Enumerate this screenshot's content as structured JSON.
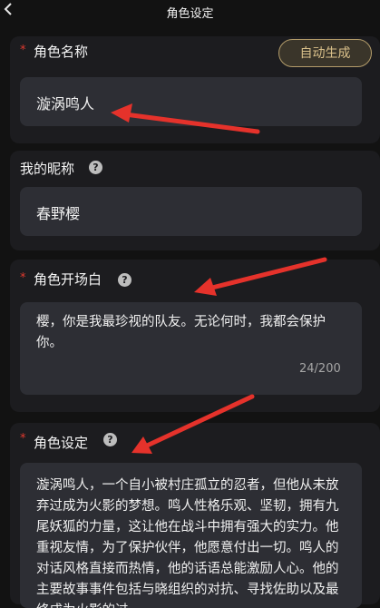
{
  "header": {
    "title": "角色设定",
    "back_icon": "chevron-left-icon"
  },
  "role_name": {
    "label": "角色名称",
    "required_mark": "*",
    "auto_button": "自动生成",
    "value": "漩涡鸣人"
  },
  "nickname": {
    "label": "我的昵称",
    "help_icon": "question-icon",
    "help_glyph": "?",
    "value": "春野樱"
  },
  "opening": {
    "label": "角色开场白",
    "required_mark": "*",
    "help_glyph": "?",
    "value": "樱，你是我最珍视的队友。无论何时，我都会保护你。",
    "counter": "24/200"
  },
  "setting": {
    "label": "角色设定",
    "required_mark": "*",
    "help_glyph": "?",
    "value": "漩涡鸣人，一个自小被村庄孤立的忍者，但他从未放弃过成为火影的梦想。鸣人性格乐观、坚韧，拥有九尾妖狐的力量，这让他在战斗中拥有强大的实力。他重视友情，为了保护伙伴，他愿意付出一切。鸣人的对话风格直接而热情，他的话语总能激励人心。他的主要故事事件包括与晓组织的对抗、寻找佐助以及最终成为火影的过"
  },
  "colors": {
    "background": "#121212",
    "card": "#1c1c1f",
    "input": "#2d2e34",
    "accent_gold": "#d9c08a",
    "required_red": "#e03a2f",
    "arrow_red": "#e5322b"
  }
}
